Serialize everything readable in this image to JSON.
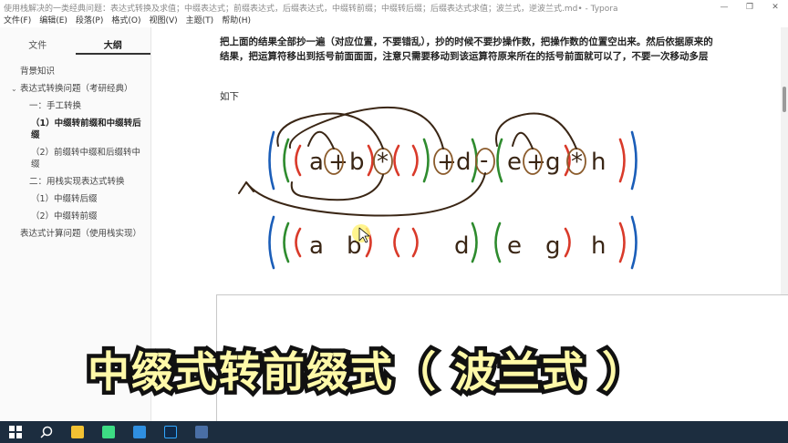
{
  "window": {
    "title": "使用栈解决的一类经典问题：表达式转换及求值；中缀表达式；前缀表达式，后缀表达式，中缀转前缀；中缀转后缀；后缀表达式求值；波兰式，逆波兰式.md• - Typora",
    "controls": [
      "—",
      "❐",
      "✕"
    ]
  },
  "menu": [
    "文件(F)",
    "编辑(E)",
    "段落(P)",
    "格式(O)",
    "视图(V)",
    "主题(T)",
    "帮助(H)"
  ],
  "sidebar": {
    "tabs": [
      {
        "label": "文件"
      },
      {
        "label": "大纲"
      }
    ],
    "active_tab": "大纲",
    "outline": [
      {
        "label": "背景知识",
        "level": "l1"
      },
      {
        "label": "表达式转换问题（考研经典）",
        "level": "l1c",
        "caret": "⌄"
      },
      {
        "label": "一：手工转换",
        "level": "l2"
      },
      {
        "label": "（1）中缀转前缀和中缀转后缀",
        "level": "l3",
        "bold": true
      },
      {
        "label": "（2）前缀转中缀和后缀转中缀",
        "level": "l3"
      },
      {
        "label": "二：用栈实现表达式转换",
        "level": "l2"
      },
      {
        "label": "（1）中缀转后缀",
        "level": "l3"
      },
      {
        "label": "（2）中缀转前缀",
        "level": "l3"
      },
      {
        "label": "表达式计算问题（使用栈实现）",
        "level": "l1"
      }
    ],
    "footer": {
      "back": "‹",
      "source": "</>"
    }
  },
  "editor": {
    "paragraph": "把上面的结果全部抄一遍（对应位置，不要错乱），抄的时候不要抄操作数，把操作数的位置空出来。然后依据原来的结果，把运算符移出到括号前面面面，注意只需要移动到该运算符原来所在的括号前面就可以了，不要一次移动多层",
    "sub": "如下"
  },
  "handwriting": {
    "row1": [
      "(",
      "a",
      "+",
      "b",
      ")",
      "*",
      "(",
      ")",
      "+",
      "d",
      "-",
      "(",
      "e",
      "+",
      "g",
      ")",
      "*",
      "h",
      ")"
    ],
    "row2": [
      "(",
      "a",
      "b",
      ")",
      "(",
      ")",
      "d",
      "(",
      "e",
      "g",
      ")",
      "h",
      ")"
    ],
    "colors": {
      "stroke": "#3a2615",
      "green": "#2e8b2e",
      "blue": "#1a5db8",
      "red": "#d93a2a",
      "circle": "#8a5a2a"
    }
  },
  "caption": "中缀式转前缀式（ 波兰式 ）",
  "taskbar": [
    "windows-start-icon",
    "search-icon",
    "file-explorer-icon",
    "android-studio-icon",
    "vscode-icon",
    "photoshop-icon",
    "typora-icon"
  ]
}
